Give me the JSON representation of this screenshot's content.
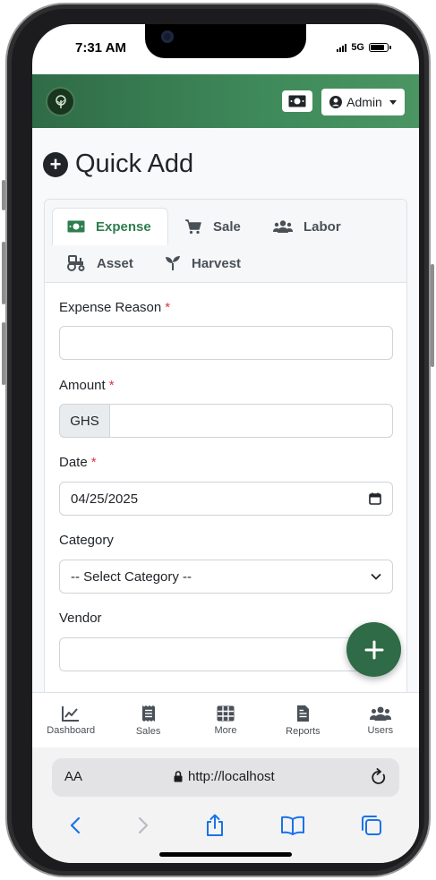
{
  "status": {
    "time": "7:31 AM",
    "network": "5G",
    "battery_level": 0.85
  },
  "topbar": {
    "user_label": "Admin"
  },
  "page": {
    "title": "Quick Add"
  },
  "tabs": [
    {
      "label": "Expense",
      "icon": "money-bill-icon",
      "active": true
    },
    {
      "label": "Sale",
      "icon": "cart-icon",
      "active": false
    },
    {
      "label": "Labor",
      "icon": "users-icon",
      "active": false
    },
    {
      "label": "Asset",
      "icon": "tractor-icon",
      "active": false
    },
    {
      "label": "Harvest",
      "icon": "seedling-icon",
      "active": false
    }
  ],
  "form": {
    "reason_label": "Expense Reason",
    "reason_value": "",
    "amount_label": "Amount",
    "currency": "GHS",
    "amount_value": "",
    "date_label": "Date",
    "date_value": "04/25/2025",
    "category_label": "Category",
    "category_value": "-- Select Category --",
    "vendor_label": "Vendor",
    "vendor_value": "",
    "required_marker": "*"
  },
  "bottom_nav": [
    {
      "label": "Dashboard",
      "icon": "chart-line-icon"
    },
    {
      "label": "Sales",
      "icon": "receipt-icon"
    },
    {
      "label": "More",
      "icon": "grid-icon"
    },
    {
      "label": "Reports",
      "icon": "file-icon"
    },
    {
      "label": "Users",
      "icon": "users-icon"
    }
  ],
  "browser": {
    "text_size_label": "AA",
    "url": "http://localhost"
  },
  "colors": {
    "brand_green": "#2e7d4e",
    "required": "#dc3545",
    "fab": "#2e6b46"
  }
}
